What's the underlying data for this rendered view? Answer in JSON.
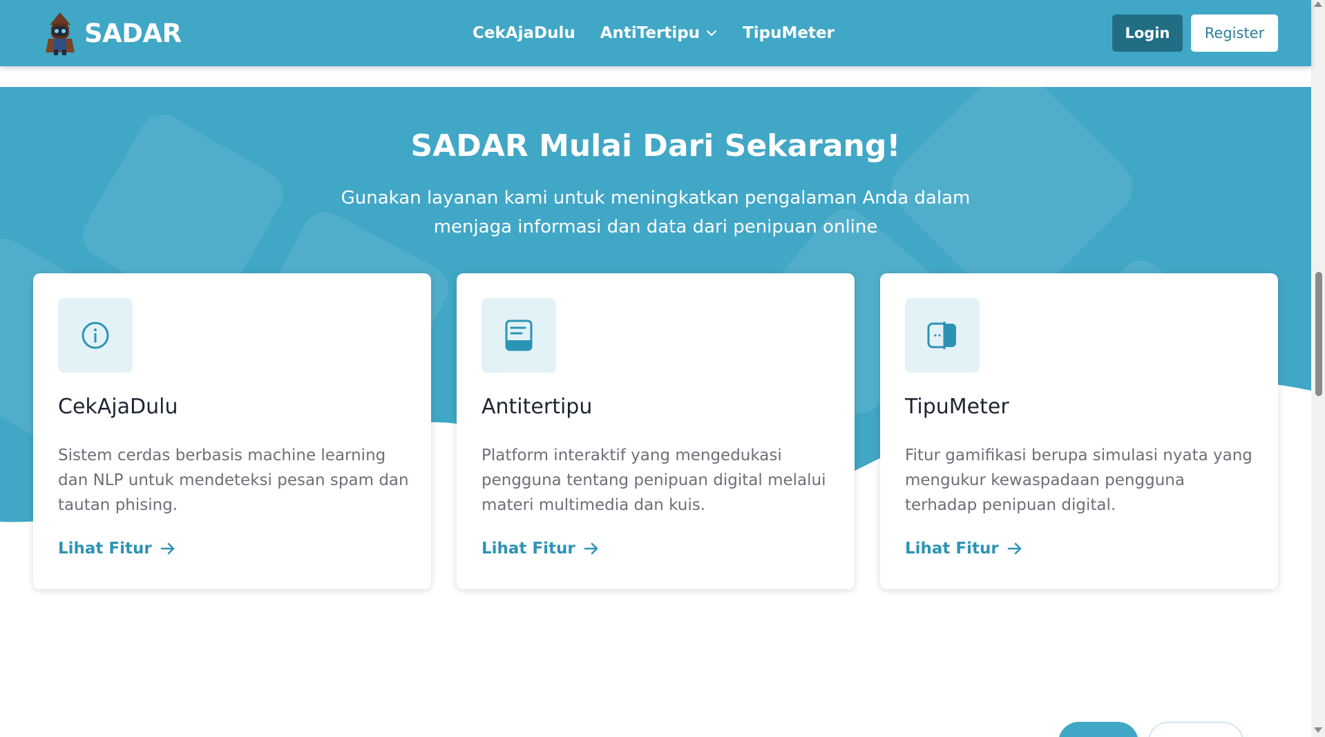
{
  "brand": {
    "name": "SADAR"
  },
  "nav": {
    "links": [
      {
        "label": "CekAjaDulu"
      },
      {
        "label": "AntiTertipu"
      },
      {
        "label": "TipuMeter"
      }
    ],
    "login_label": "Login",
    "register_label": "Register"
  },
  "hero": {
    "title": "SADAR Mulai Dari Sekarang!",
    "subtitle": "Gunakan layanan kami untuk meningkatkan pengalaman Anda dalam menjaga informasi dan data dari penipuan online"
  },
  "cards": [
    {
      "icon": "info-circle-icon",
      "title": "CekAjaDulu",
      "description": "Sistem cerdas berbasis machine learning dan NLP untuk mendeteksi pesan spam dan tautan phising.",
      "link_label": "Lihat Fitur"
    },
    {
      "icon": "book-icon",
      "title": "Antitertipu",
      "description": "Platform interaktif yang mengedukasi pengguna tentang penipuan digital melalui materi multimedia dan kuis.",
      "link_label": "Lihat Fitur"
    },
    {
      "icon": "gauge-toggle-icon",
      "title": "TipuMeter",
      "description": "Fitur gamifikasi berupa simulasi nyata yang mengukur kewaspadaan pengguna terhadap penipuan digital.",
      "link_label": "Lihat Fitur"
    }
  ],
  "colors": {
    "primary": "#41a7c6",
    "dark_button": "#216e84",
    "link": "#2d93b4",
    "icon_bg": "#e3f2f7"
  }
}
